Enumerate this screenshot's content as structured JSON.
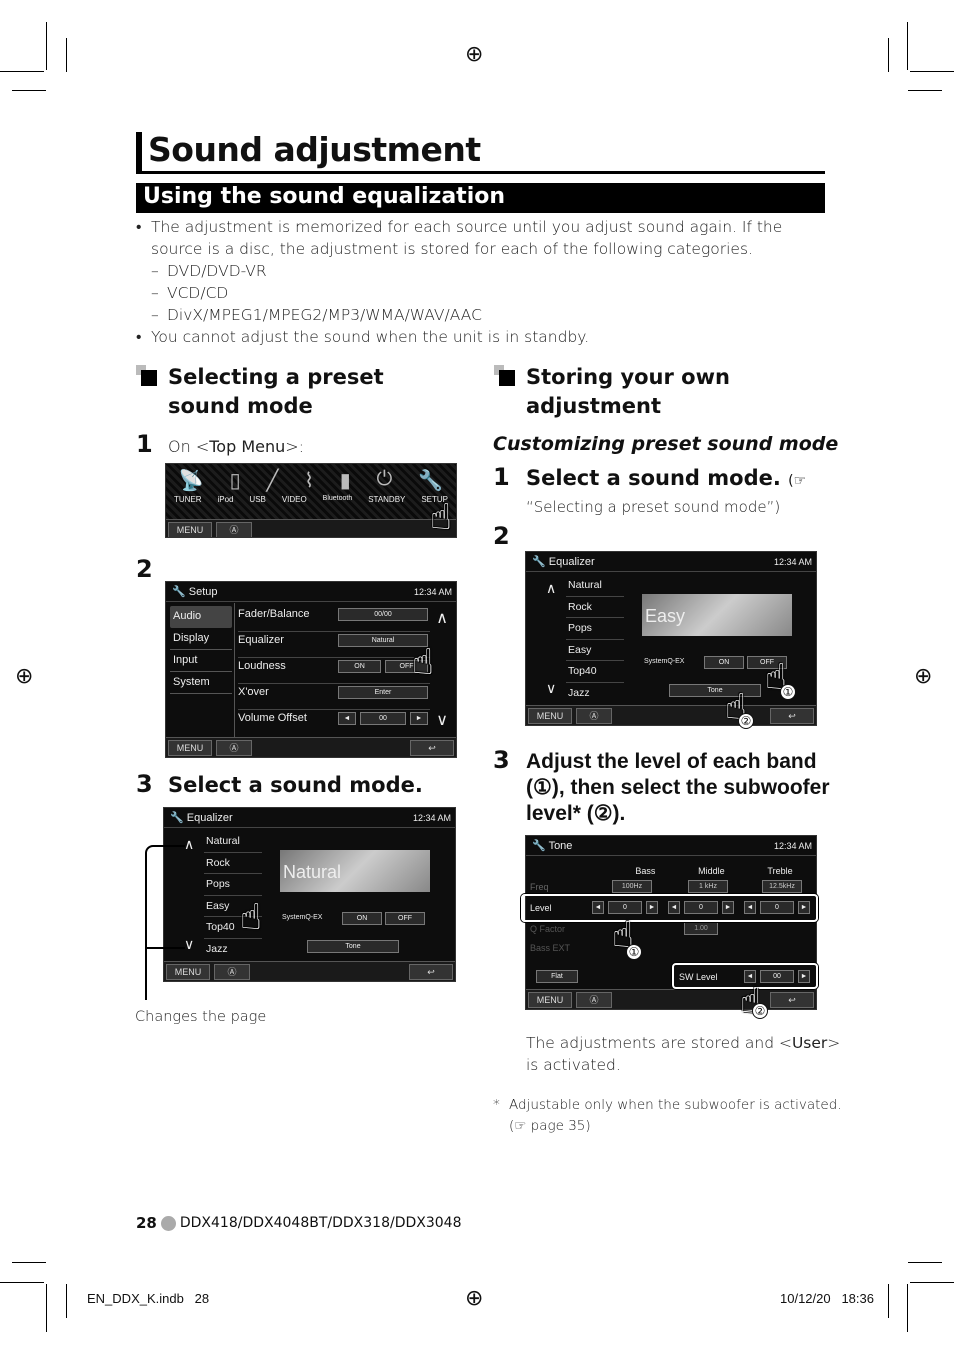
{
  "title": "Sound adjustment",
  "section": "Using the sound equalization",
  "bullets": [
    "The adjustment is memorized for each source until you adjust sound again. If the source is a disc, the adjustment is stored for each of the following categories.",
    "You cannot adjust the sound when the unit is in standby."
  ],
  "categories": [
    "DVD/DVD-VR",
    "VCD/CD",
    "DivX/MPEG1/MPEG2/MP3/WMA/WAV/AAC"
  ],
  "left": {
    "heading": "Selecting a preset sound mode",
    "step1_num": "1",
    "step1_pre": "On <",
    "step1_bold": "Top Menu",
    "step1_post": ">:",
    "step2_num": "2",
    "step3_num": "3",
    "step3_text": "Select a sound mode.",
    "caption": "Changes the page",
    "topmenu": {
      "items": [
        "TUNER",
        "iPod",
        "USB",
        "VIDEO",
        "Bluetooth",
        "STANDBY",
        "SETUP"
      ],
      "menu": "MENU"
    },
    "setup": {
      "title": "Setup",
      "time": "12:34 AM",
      "tabs": [
        "Audio",
        "Display",
        "Input",
        "System"
      ],
      "rows": [
        {
          "label": "Fader/Balance",
          "value": "00/00"
        },
        {
          "label": "Equalizer",
          "value": "Natural"
        },
        {
          "label": "Loudness",
          "on": "ON",
          "off": "OFF"
        },
        {
          "label": "X'over",
          "value": "Enter"
        },
        {
          "label": "Volume Offset",
          "value": "00"
        }
      ],
      "menu": "MENU"
    },
    "eq": {
      "title": "Equalizer",
      "time": "12:34 AM",
      "modes": [
        "Natural",
        "Rock",
        "Pops",
        "Easy",
        "Top40",
        "Jazz"
      ],
      "current": "Natural",
      "sysq": "SystemQ-EX",
      "on": "ON",
      "off": "OFF",
      "tone": "Tone",
      "menu": "MENU"
    }
  },
  "right": {
    "heading": "Storing your own adjustment",
    "subheading": "Customizing preset sound mode",
    "step1_num": "1",
    "step1_text": "Select a sound mode.",
    "step1_ref": "(☞",
    "step1_sub": "“Selecting a preset sound mode”)",
    "step2_num": "2",
    "step3_num": "3",
    "step3_a": "Adjust the level of each band",
    "step3_b": "(①), then select the subwoofer",
    "step3_c": "level* (②).",
    "eq": {
      "title": "Equalizer",
      "time": "12:34 AM",
      "modes": [
        "Natural",
        "Rock",
        "Pops",
        "Easy",
        "Top40",
        "Jazz"
      ],
      "current": "Easy",
      "sysq": "SystemQ-EX",
      "on": "ON",
      "off": "OFF",
      "tone": "Tone",
      "menu": "MENU"
    },
    "tone": {
      "title": "Tone",
      "time": "12:34 AM",
      "bands": [
        "Bass",
        "Middle",
        "Treble"
      ],
      "freq_label": "Freq",
      "freqs": [
        "100Hz",
        "1 kHz",
        "12.5kHz"
      ],
      "level_label": "Level",
      "levels": [
        "0",
        "0",
        "0"
      ],
      "q_label": "Q Factor",
      "q_value": "1.00",
      "bassext_label": "Bass EXT",
      "flat": "Flat",
      "sw_label": "SW Level",
      "sw_value": "00",
      "menu": "MENU"
    },
    "stored_pre": "The adjustments are stored and <",
    "stored_bold": "User",
    "stored_post": ">",
    "stored_line2": "is activated.",
    "note_mark": "*",
    "note": "Adjustable only when the subwoofer is activated.",
    "note_ref": "(☞ page 35)"
  },
  "callouts": [
    "①",
    "②"
  ],
  "footer": {
    "page": "28",
    "models": "DDX418/DDX4048BT/DDX318/DDX3048",
    "file": "EN_DDX_K.indb   28",
    "date": "10/12/20   18:36"
  }
}
